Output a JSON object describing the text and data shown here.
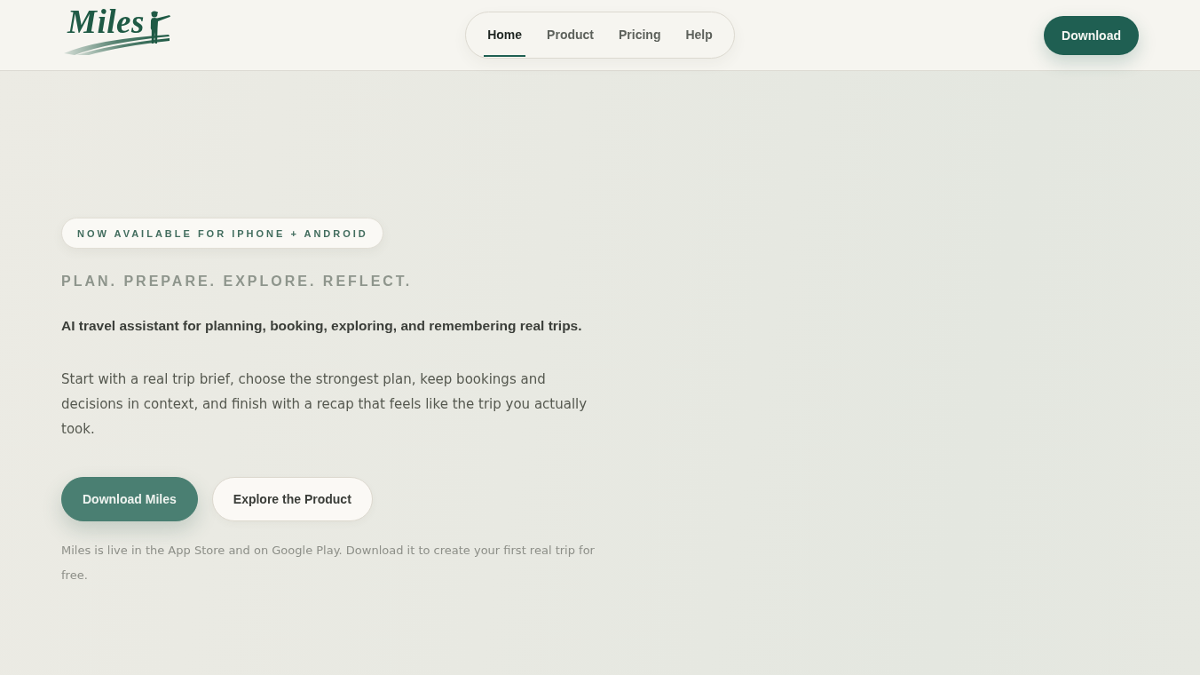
{
  "header": {
    "logo": {
      "text": "Miles"
    },
    "nav": [
      {
        "label": "Home",
        "selected": true
      },
      {
        "label": "Product",
        "selected": false
      },
      {
        "label": "Pricing",
        "selected": false
      },
      {
        "label": "Help",
        "selected": false
      }
    ],
    "download_button": "Download"
  },
  "hero": {
    "badge": "NOW AVAILABLE FOR IPHONE + ANDROID",
    "tagline": "PLAN. PREPARE. EXPLORE. REFLECT.",
    "lead": "AI travel assistant for planning, booking, exploring, and remembering real trips.",
    "body": "Start with a real trip brief, choose the strongest plan, keep bookings and decisions in context, and finish with a recap that feels like the trip you actually took.",
    "buttons": [
      {
        "label": "Download Miles",
        "kind": "primary"
      },
      {
        "label": "Explore the Product",
        "kind": "secondary"
      }
    ],
    "note": "Miles is live in the App Store and on Google Play. Download it to create your first real trip for free."
  }
}
